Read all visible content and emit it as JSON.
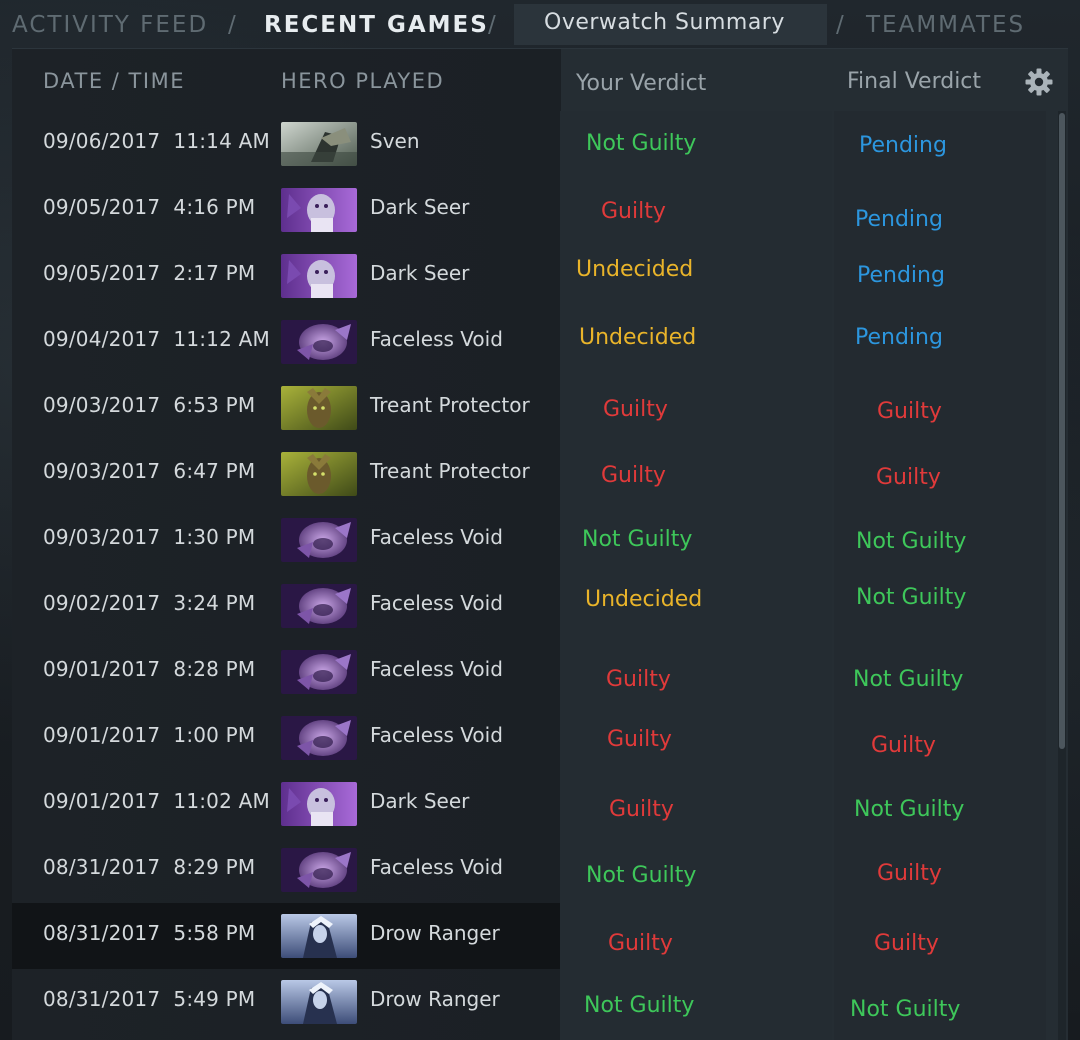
{
  "nav": {
    "activity_feed": "ACTIVITY FEED",
    "sep": "/",
    "recent_games": "RECENT GAMES",
    "overwatch_summary": "Overwatch Summary",
    "teammates": "TEAMMATES"
  },
  "table": {
    "headers": {
      "date_time": "DATE / TIME",
      "hero_played": "HERO PLAYED",
      "your_verdict": "Your Verdict",
      "final_verdict": "Final Verdict"
    },
    "rows": [
      {
        "datetime": "09/06/2017  11:14 AM",
        "hero": "Sven",
        "hero_icon": "sven-portrait",
        "your_verdict": "Not Guilty",
        "final_verdict": "Pending"
      },
      {
        "datetime": "09/05/2017  4:16 PM",
        "hero": "Dark Seer",
        "hero_icon": "dark-seer-portrait",
        "your_verdict": "Guilty",
        "final_verdict": "Pending"
      },
      {
        "datetime": "09/05/2017  2:17 PM",
        "hero": "Dark Seer",
        "hero_icon": "dark-seer-portrait",
        "your_verdict": "Undecided",
        "final_verdict": "Pending"
      },
      {
        "datetime": "09/04/2017  11:12 AM",
        "hero": "Faceless Void",
        "hero_icon": "faceless-void-portrait",
        "your_verdict": "Undecided",
        "final_verdict": "Pending"
      },
      {
        "datetime": "09/03/2017  6:53 PM",
        "hero": "Treant Protector",
        "hero_icon": "treant-protector-portrait",
        "your_verdict": "Guilty",
        "final_verdict": "Guilty"
      },
      {
        "datetime": "09/03/2017  6:47 PM",
        "hero": "Treant Protector",
        "hero_icon": "treant-protector-portrait",
        "your_verdict": "Guilty",
        "final_verdict": "Guilty"
      },
      {
        "datetime": "09/03/2017  1:30 PM",
        "hero": "Faceless Void",
        "hero_icon": "faceless-void-portrait",
        "your_verdict": "Not Guilty",
        "final_verdict": "Not Guilty"
      },
      {
        "datetime": "09/02/2017  3:24 PM",
        "hero": "Faceless Void",
        "hero_icon": "faceless-void-portrait",
        "your_verdict": "Undecided",
        "final_verdict": "Not Guilty"
      },
      {
        "datetime": "09/01/2017  8:28 PM",
        "hero": "Faceless Void",
        "hero_icon": "faceless-void-portrait",
        "your_verdict": "Guilty",
        "final_verdict": "Not Guilty"
      },
      {
        "datetime": "09/01/2017  1:00 PM",
        "hero": "Faceless Void",
        "hero_icon": "faceless-void-portrait",
        "your_verdict": "Guilty",
        "final_verdict": "Guilty"
      },
      {
        "datetime": "09/01/2017  11:02 AM",
        "hero": "Dark Seer",
        "hero_icon": "dark-seer-portrait",
        "your_verdict": "Guilty",
        "final_verdict": "Not Guilty"
      },
      {
        "datetime": "08/31/2017  8:29 PM",
        "hero": "Faceless Void",
        "hero_icon": "faceless-void-portrait",
        "your_verdict": "Not Guilty",
        "final_verdict": "Guilty"
      },
      {
        "datetime": "08/31/2017  5:58 PM",
        "hero": "Drow Ranger",
        "hero_icon": "drow-ranger-portrait",
        "your_verdict": "Guilty",
        "final_verdict": "Guilty"
      },
      {
        "datetime": "08/31/2017  5:49 PM",
        "hero": "Drow Ranger",
        "hero_icon": "drow-ranger-portrait",
        "your_verdict": "Not Guilty",
        "final_verdict": "Not Guilty"
      }
    ]
  },
  "colors": {
    "not_guilty": "#3ec75a",
    "guilty": "#e03a3a",
    "undecided": "#e9b42a",
    "pending": "#2c96de"
  },
  "settings_icon": "gear-icon"
}
